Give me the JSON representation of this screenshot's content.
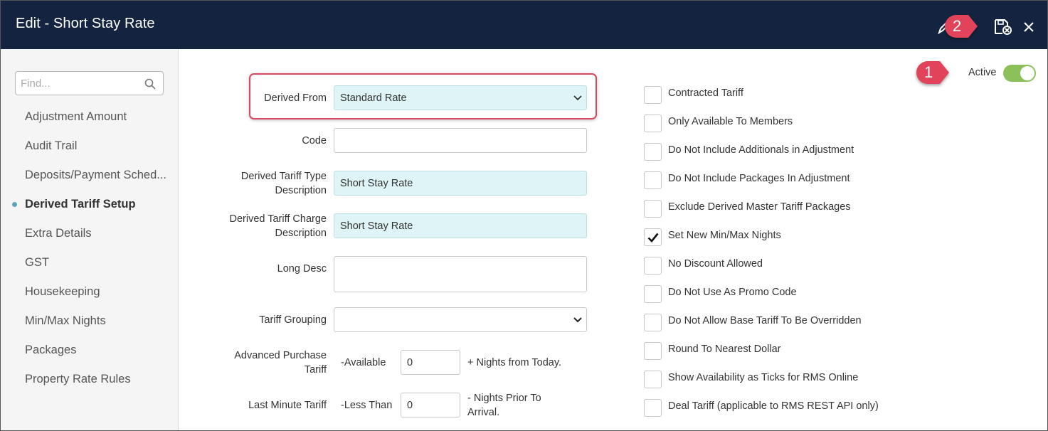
{
  "window": {
    "title": "Edit - Short Stay Rate"
  },
  "callouts": {
    "one": "1",
    "two": "2",
    "color": "#e0435a"
  },
  "sidebar": {
    "search_placeholder": "Find...",
    "active_index": 3,
    "items": [
      {
        "label": "Adjustment Amount"
      },
      {
        "label": "Audit Trail"
      },
      {
        "label": "Deposits/Payment Sched..."
      },
      {
        "label": "Derived Tariff Setup"
      },
      {
        "label": "Extra Details"
      },
      {
        "label": "GST"
      },
      {
        "label": "Housekeeping"
      },
      {
        "label": "Min/Max Nights"
      },
      {
        "label": "Packages"
      },
      {
        "label": "Property Rate Rules"
      }
    ]
  },
  "form": {
    "derived_from": {
      "label": "Derived From",
      "value": "Standard Rate"
    },
    "code": {
      "label": "Code",
      "value": ""
    },
    "type_desc": {
      "label_line1": "Derived Tariff Type",
      "label_line2": "Description",
      "value": "Short Stay Rate"
    },
    "charge_desc": {
      "label_line1": "Derived Tariff Charge",
      "label_line2": "Description",
      "value": "Short Stay Rate"
    },
    "long_desc": {
      "label": "Long Desc",
      "value": ""
    },
    "tariff_grouping": {
      "label": "Tariff Grouping",
      "value": ""
    },
    "advanced_purchase": {
      "label_line1": "Advanced Purchase",
      "label_line2": "Tariff",
      "prefix": "-Available",
      "value": "0",
      "suffix": "+ Nights from Today."
    },
    "last_minute": {
      "label": "Last Minute Tariff",
      "prefix": "-Less Than",
      "value": "0",
      "suffix_line1": "- Nights Prior To",
      "suffix_line2": "Arrival."
    }
  },
  "active_toggle": {
    "label": "Active",
    "on": true,
    "color": "#8bc05a"
  },
  "options": [
    {
      "label": "Contracted Tariff",
      "checked": false
    },
    {
      "label": "Only Available To Members",
      "checked": false
    },
    {
      "label": "Do Not Include Additionals in Adjustment",
      "checked": false
    },
    {
      "label": "Do Not Include Packages In Adjustment",
      "checked": false
    },
    {
      "label": "Exclude Derived Master Tariff Packages",
      "checked": false
    },
    {
      "label": "Set New Min/Max Nights",
      "checked": true
    },
    {
      "label": "No Discount Allowed",
      "checked": false
    },
    {
      "label": "Do Not Use As Promo Code",
      "checked": false
    },
    {
      "label": "Do Not Allow Base Tariff To Be Overridden",
      "checked": false
    },
    {
      "label": "Round To Nearest Dollar",
      "checked": false
    },
    {
      "label": "Show Availability as Ticks for RMS Online",
      "checked": false
    },
    {
      "label": "Deal Tariff (applicable to RMS REST API only)",
      "checked": false
    }
  ],
  "theme": {
    "header_bg": "#142440",
    "field_highlight_bg": "#dff4f7",
    "callout_border": "#d6485f"
  }
}
